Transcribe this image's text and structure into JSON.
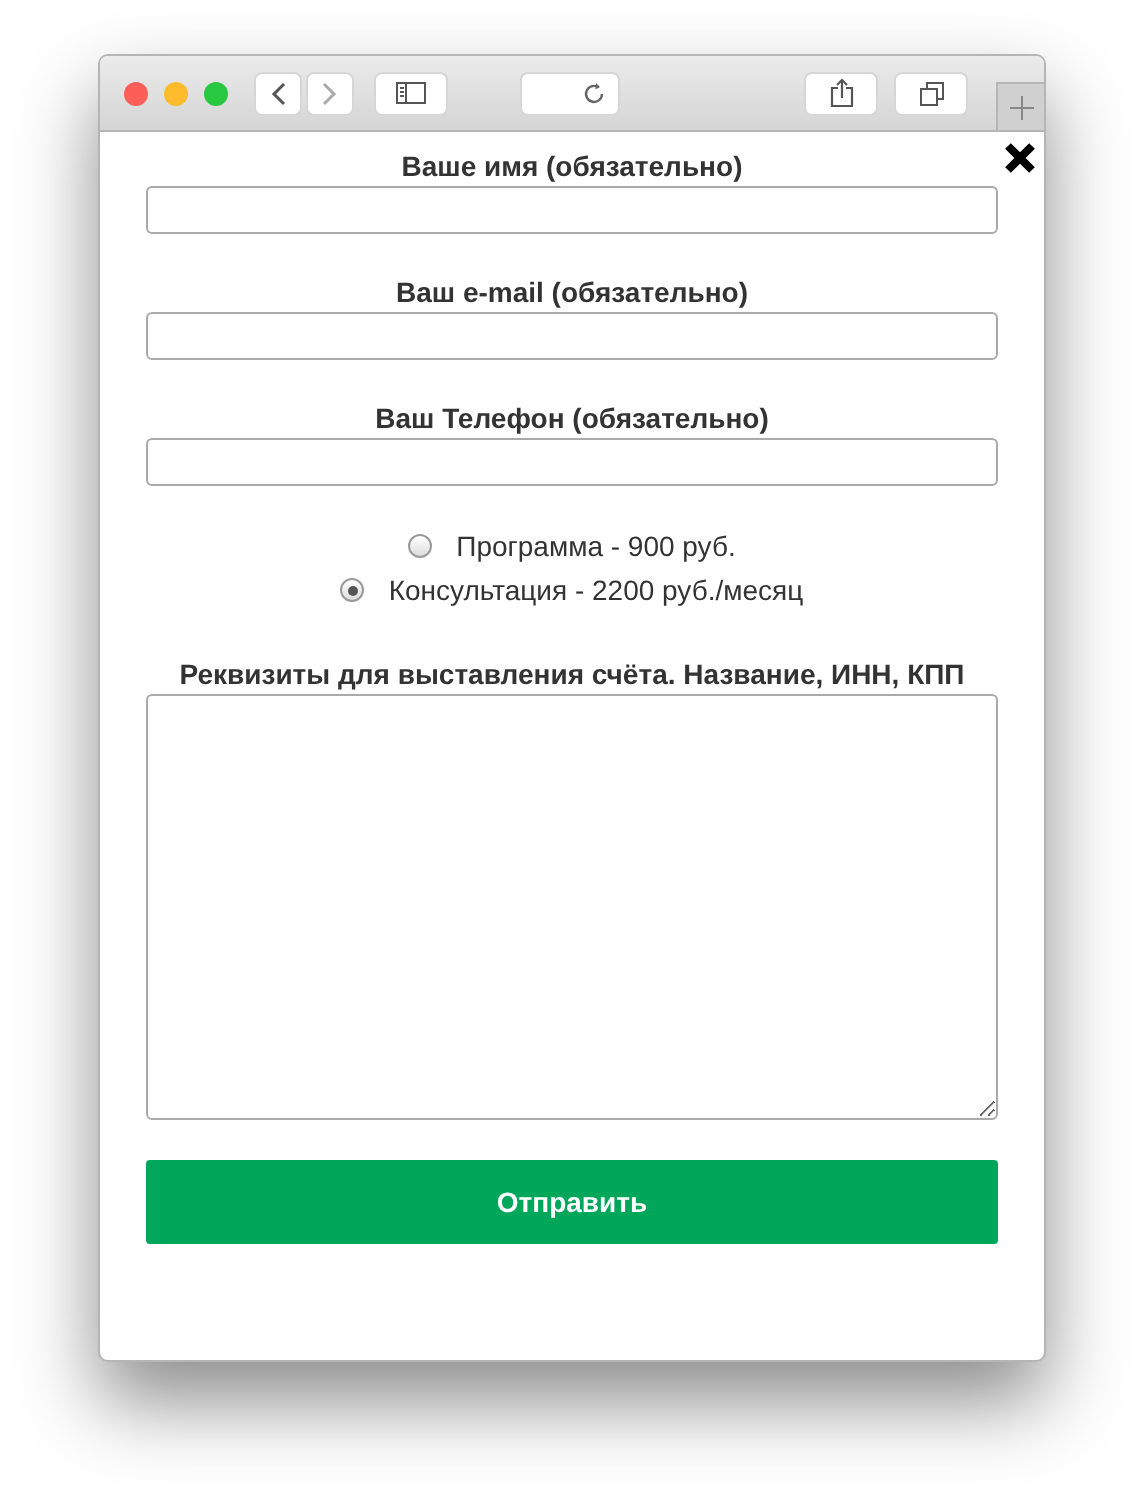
{
  "fields": [
    {
      "label": "Ваше имя (обязательно)"
    },
    {
      "label": "Ваш e-mail (обязательно)"
    },
    {
      "label": "Ваш Телефон (обязательно)"
    }
  ],
  "options": [
    {
      "label": "Программа - 900 руб.",
      "selected": false
    },
    {
      "label": "Консультация - 2200 руб./месяц",
      "selected": true
    }
  ],
  "details": {
    "label": "Реквизиты для выставления счёта. Название, ИНН, КПП"
  },
  "submit": "Отправить"
}
